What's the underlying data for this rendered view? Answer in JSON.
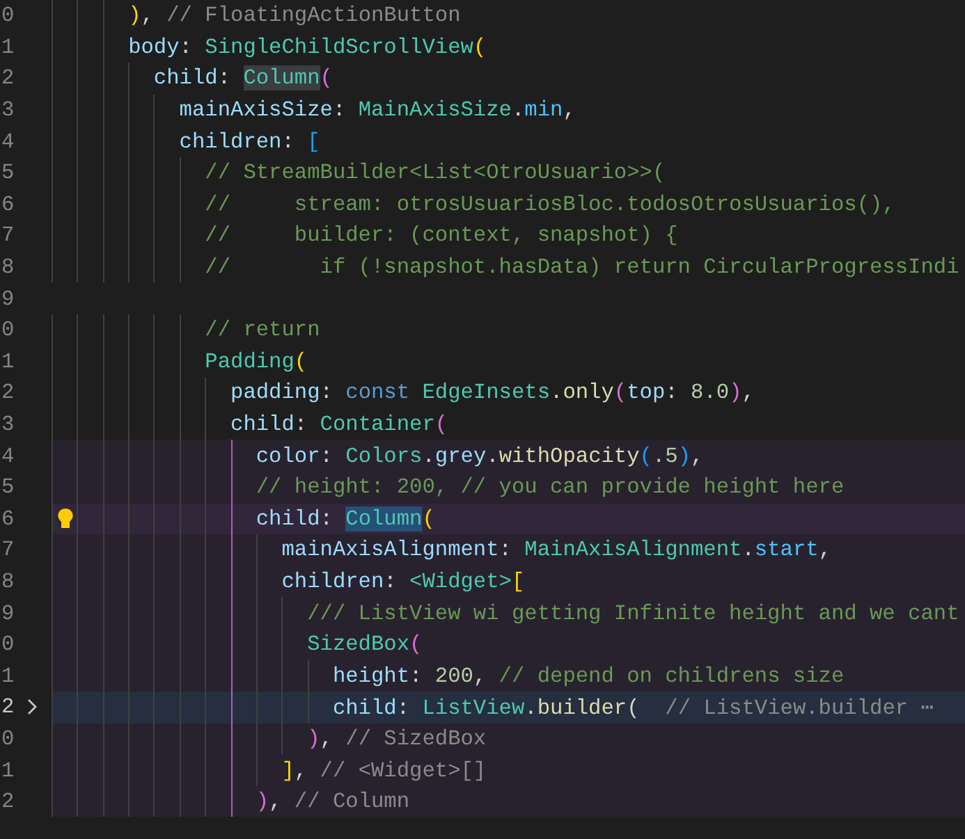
{
  "editor": {
    "lines": [
      {
        "number": "0",
        "current": false,
        "lightbulb": false,
        "folded": false,
        "symbol_line": false,
        "scope": false,
        "tokens": [
          {
            "kind": "gold",
            "text": "      )"
          },
          {
            "kind": "plain",
            "text": ", "
          },
          {
            "kind": "label",
            "text": "// FloatingActionButton"
          }
        ]
      },
      {
        "number": "1",
        "current": false,
        "lightbulb": false,
        "folded": false,
        "symbol_line": false,
        "scope": false,
        "tokens": [
          {
            "kind": "prop",
            "text": "      body"
          },
          {
            "kind": "plain",
            "text": ": "
          },
          {
            "kind": "type",
            "text": "SingleChildScrollView"
          },
          {
            "kind": "gold",
            "text": "("
          }
        ]
      },
      {
        "number": "2",
        "current": false,
        "lightbulb": false,
        "folded": false,
        "symbol_line": false,
        "scope": false,
        "tokens": [
          {
            "kind": "prop",
            "text": "        child"
          },
          {
            "kind": "plain",
            "text": ": "
          },
          {
            "kind": "type",
            "text": "Column",
            "occurrence": true
          },
          {
            "kind": "pink",
            "text": "("
          }
        ]
      },
      {
        "number": "3",
        "current": false,
        "lightbulb": false,
        "folded": false,
        "symbol_line": false,
        "scope": false,
        "tokens": [
          {
            "kind": "prop",
            "text": "          mainAxisSize"
          },
          {
            "kind": "plain",
            "text": ": "
          },
          {
            "kind": "type",
            "text": "MainAxisSize"
          },
          {
            "kind": "plain",
            "text": "."
          },
          {
            "kind": "const",
            "text": "min"
          },
          {
            "kind": "plain",
            "text": ","
          }
        ]
      },
      {
        "number": "4",
        "current": false,
        "lightbulb": false,
        "folded": false,
        "symbol_line": false,
        "scope": false,
        "tokens": [
          {
            "kind": "prop",
            "text": "          children"
          },
          {
            "kind": "plain",
            "text": ": "
          },
          {
            "kind": "blue",
            "text": "["
          }
        ]
      },
      {
        "number": "5",
        "current": false,
        "lightbulb": false,
        "folded": false,
        "symbol_line": false,
        "scope": false,
        "tokens": [
          {
            "kind": "comment",
            "text": "            // StreamBuilder<List<OtroUsuario>>("
          }
        ]
      },
      {
        "number": "6",
        "current": false,
        "lightbulb": false,
        "folded": false,
        "symbol_line": false,
        "scope": false,
        "tokens": [
          {
            "kind": "comment",
            "text": "            //     stream: otrosUsuariosBloc.todosOtrosUsuarios(),"
          }
        ]
      },
      {
        "number": "7",
        "current": false,
        "lightbulb": false,
        "folded": false,
        "symbol_line": false,
        "scope": false,
        "tokens": [
          {
            "kind": "comment",
            "text": "            //     builder: (context, snapshot) {"
          }
        ]
      },
      {
        "number": "8",
        "current": false,
        "lightbulb": false,
        "folded": false,
        "symbol_line": false,
        "scope": false,
        "tokens": [
          {
            "kind": "comment",
            "text": "            //       if (!snapshot.hasData) return CircularProgressIndi"
          }
        ]
      },
      {
        "number": "9",
        "current": false,
        "lightbulb": false,
        "folded": false,
        "symbol_line": false,
        "scope": false
      },
      {
        "number": "0",
        "current": false,
        "lightbulb": false,
        "folded": false,
        "symbol_line": false,
        "scope": false,
        "tokens": [
          {
            "kind": "comment",
            "text": "            // return"
          }
        ]
      },
      {
        "number": "1",
        "current": false,
        "lightbulb": false,
        "folded": false,
        "symbol_line": false,
        "scope": false,
        "tokens": [
          {
            "kind": "type",
            "text": "            Padding"
          },
          {
            "kind": "gold",
            "text": "("
          }
        ]
      },
      {
        "number": "2",
        "current": false,
        "lightbulb": false,
        "folded": false,
        "symbol_line": false,
        "scope": false,
        "tokens": [
          {
            "kind": "prop",
            "text": "              padding"
          },
          {
            "kind": "plain",
            "text": ": "
          },
          {
            "kind": "keyword",
            "text": "const "
          },
          {
            "kind": "type",
            "text": "EdgeInsets"
          },
          {
            "kind": "plain",
            "text": "."
          },
          {
            "kind": "method",
            "text": "only"
          },
          {
            "kind": "pink",
            "text": "("
          },
          {
            "kind": "prop",
            "text": "top"
          },
          {
            "kind": "plain",
            "text": ": "
          },
          {
            "kind": "number",
            "text": "8.0"
          },
          {
            "kind": "pink",
            "text": ")"
          },
          {
            "kind": "plain",
            "text": ","
          }
        ]
      },
      {
        "number": "3",
        "current": false,
        "lightbulb": false,
        "folded": false,
        "symbol_line": false,
        "scope": false,
        "tokens": [
          {
            "kind": "prop",
            "text": "              child"
          },
          {
            "kind": "plain",
            "text": ": "
          },
          {
            "kind": "type",
            "text": "Container"
          },
          {
            "kind": "pink",
            "text": "("
          }
        ]
      },
      {
        "number": "4",
        "current": false,
        "lightbulb": false,
        "folded": false,
        "symbol_line": false,
        "scope": true,
        "tokens": [
          {
            "kind": "prop",
            "text": "                color"
          },
          {
            "kind": "plain",
            "text": ": "
          },
          {
            "kind": "type",
            "text": "Colors"
          },
          {
            "kind": "plain",
            "text": "."
          },
          {
            "kind": "prop",
            "text": "grey"
          },
          {
            "kind": "plain",
            "text": "."
          },
          {
            "kind": "method",
            "text": "withOpacity"
          },
          {
            "kind": "blue",
            "text": "("
          },
          {
            "kind": "number",
            "text": ".5"
          },
          {
            "kind": "blue",
            "text": ")"
          },
          {
            "kind": "plain",
            "text": ","
          }
        ]
      },
      {
        "number": "5",
        "current": false,
        "lightbulb": false,
        "folded": false,
        "symbol_line": false,
        "scope": true,
        "tokens": [
          {
            "kind": "comment",
            "text": "                // height: 200, // you can provide height here"
          }
        ]
      },
      {
        "number": "6",
        "current": false,
        "lightbulb": true,
        "folded": false,
        "symbol_line": true,
        "scope": true,
        "tokens": [
          {
            "kind": "prop",
            "text": "                child"
          },
          {
            "kind": "plain",
            "text": ": "
          },
          {
            "kind": "type",
            "text": "Column",
            "selected": true
          },
          {
            "kind": "gold",
            "text": "("
          }
        ]
      },
      {
        "number": "7",
        "current": false,
        "lightbulb": false,
        "folded": false,
        "symbol_line": false,
        "scope": true,
        "tokens": [
          {
            "kind": "prop",
            "text": "                  mainAxisAlignment"
          },
          {
            "kind": "plain",
            "text": ": "
          },
          {
            "kind": "type",
            "text": "MainAxisAlignment"
          },
          {
            "kind": "plain",
            "text": "."
          },
          {
            "kind": "const",
            "text": "start"
          },
          {
            "kind": "plain",
            "text": ","
          }
        ]
      },
      {
        "number": "8",
        "current": false,
        "lightbulb": false,
        "folded": false,
        "symbol_line": false,
        "scope": true,
        "tokens": [
          {
            "kind": "prop",
            "text": "                  children"
          },
          {
            "kind": "plain",
            "text": ": "
          },
          {
            "kind": "type",
            "text": "<Widget>"
          },
          {
            "kind": "gold",
            "text": "["
          }
        ]
      },
      {
        "number": "9",
        "current": false,
        "lightbulb": false,
        "folded": false,
        "symbol_line": false,
        "scope": true,
        "tokens": [
          {
            "kind": "comment",
            "text": "                    /// ListView wi getting Infinite height and we cant"
          }
        ]
      },
      {
        "number": "0",
        "current": false,
        "lightbulb": false,
        "folded": false,
        "symbol_line": false,
        "scope": true,
        "tokens": [
          {
            "kind": "type",
            "text": "                    SizedBox"
          },
          {
            "kind": "pink",
            "text": "("
          }
        ]
      },
      {
        "number": "1",
        "current": false,
        "lightbulb": false,
        "folded": false,
        "symbol_line": false,
        "scope": true,
        "tokens": [
          {
            "kind": "prop",
            "text": "                      height"
          },
          {
            "kind": "plain",
            "text": ": "
          },
          {
            "kind": "number",
            "text": "200"
          },
          {
            "kind": "plain",
            "text": ", "
          },
          {
            "kind": "comment",
            "text": "// depend on childrens size"
          }
        ]
      },
      {
        "number": "2",
        "current": true,
        "lightbulb": false,
        "folded": true,
        "symbol_line": false,
        "scope": true,
        "tokens": [
          {
            "kind": "prop",
            "text": "                      child"
          },
          {
            "kind": "plain",
            "text": ": "
          },
          {
            "kind": "type",
            "text": "ListView"
          },
          {
            "kind": "plain",
            "text": "."
          },
          {
            "kind": "method",
            "text": "builder"
          },
          {
            "kind": "plain",
            "text": "(  "
          },
          {
            "kind": "label",
            "text": "// ListView.builder"
          },
          {
            "kind": "fold",
            "text": " ⋯"
          }
        ]
      },
      {
        "number": "0",
        "current": false,
        "lightbulb": false,
        "folded": false,
        "symbol_line": false,
        "scope": true,
        "tokens": [
          {
            "kind": "pink",
            "text": "                    )"
          },
          {
            "kind": "plain",
            "text": ", "
          },
          {
            "kind": "label",
            "text": "// SizedBox"
          }
        ]
      },
      {
        "number": "1",
        "current": false,
        "lightbulb": false,
        "folded": false,
        "symbol_line": false,
        "scope": true,
        "tokens": [
          {
            "kind": "gold",
            "text": "                  ]"
          },
          {
            "kind": "plain",
            "text": ", "
          },
          {
            "kind": "label",
            "text": "// <Widget>[]"
          }
        ]
      },
      {
        "number": "2",
        "current": false,
        "lightbulb": false,
        "folded": false,
        "symbol_line": false,
        "scope": true,
        "tokens": [
          {
            "kind": "pink",
            "text": "                )"
          },
          {
            "kind": "plain",
            "text": ", "
          },
          {
            "kind": "label",
            "text": "// Column"
          }
        ]
      }
    ]
  }
}
